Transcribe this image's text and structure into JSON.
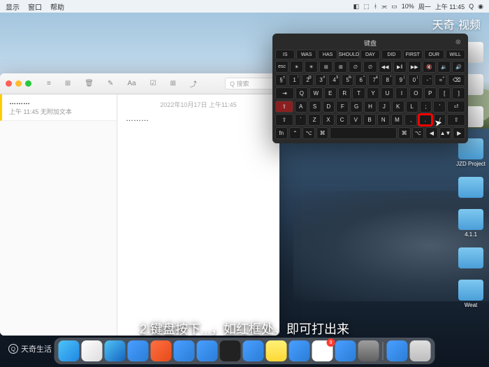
{
  "menubar": {
    "items": [
      "显示",
      "窗口",
      "帮助"
    ],
    "status": {
      "battery": "10%",
      "day": "周一",
      "time": "上午 11:45"
    }
  },
  "watermark": {
    "top_right_a": "天奇",
    "top_right_dot": "·",
    "top_right_b": "视频",
    "bottom_left": "天奇生活"
  },
  "subtitle": "2.键盘按下...，如红框处，即可打出来",
  "notes": {
    "toolbar": {
      "view": "≡",
      "grid": "⊞",
      "delete": "🗑",
      "edit": "✎",
      "format": "Aa",
      "table": "⊞",
      "share": "⤴",
      "search_placeholder": "Q 搜索"
    },
    "list": [
      {
        "title": "………",
        "time": "上午 11:45",
        "sub": "无附加文本"
      }
    ],
    "content": {
      "date": "2022年10月17日 上午11:45",
      "text": "………"
    }
  },
  "keyboard": {
    "title": "键盘",
    "suggestions": [
      "IS",
      "WAS",
      "HAS",
      "SHOULD",
      "DAY",
      "DID",
      "FIRST",
      "OUR",
      "WILL"
    ],
    "fn_row": [
      "esc",
      "☀",
      "☀",
      "⊞",
      "⊞",
      "∅",
      "∅",
      "◀◀",
      "▶‖",
      "▶▶",
      "🔇",
      "🔉",
      "🔊"
    ],
    "num_row": [
      [
        "§",
        "±"
      ],
      [
        "1",
        "!"
      ],
      [
        "2",
        "@"
      ],
      [
        "3",
        "#"
      ],
      [
        "4",
        "$"
      ],
      [
        "5",
        "%"
      ],
      [
        "6",
        "^"
      ],
      [
        "7",
        "&"
      ],
      [
        "8",
        "*"
      ],
      [
        "9",
        "("
      ],
      [
        "0",
        ")"
      ],
      [
        "-",
        "_"
      ],
      [
        "=",
        "+"
      ],
      [
        "⌫",
        ""
      ]
    ],
    "qwerty": [
      "⇥",
      "Q",
      "W",
      "E",
      "R",
      "T",
      "Y",
      "U",
      "I",
      "O",
      "P",
      "[",
      "]"
    ],
    "asdf": [
      "⇪",
      "A",
      "S",
      "D",
      "F",
      "G",
      "H",
      "J",
      "K",
      "L",
      ";",
      "'",
      "⏎"
    ],
    "zxcv": [
      "⇧",
      "`",
      "Z",
      "X",
      "C",
      "V",
      "B",
      "N",
      "M",
      ",",
      ".",
      "/",
      "⇧"
    ],
    "bottom": [
      "fn",
      "⌃",
      "⌥",
      "⌘",
      "",
      "⌘",
      "⌥",
      "◀",
      "▲▼",
      "▶"
    ]
  },
  "desktop": [
    {
      "type": "app",
      "label": ""
    },
    {
      "type": "app",
      "label": ""
    },
    {
      "type": "app",
      "label": ""
    },
    {
      "type": "folder",
      "label": "JZD Project"
    },
    {
      "type": "folder",
      "label": ""
    },
    {
      "type": "folder",
      "label": "4.1.1"
    },
    {
      "type": "folder",
      "label": ""
    },
    {
      "type": "folder",
      "label": "Weat"
    }
  ],
  "dock": {
    "badge_qq": "9"
  }
}
